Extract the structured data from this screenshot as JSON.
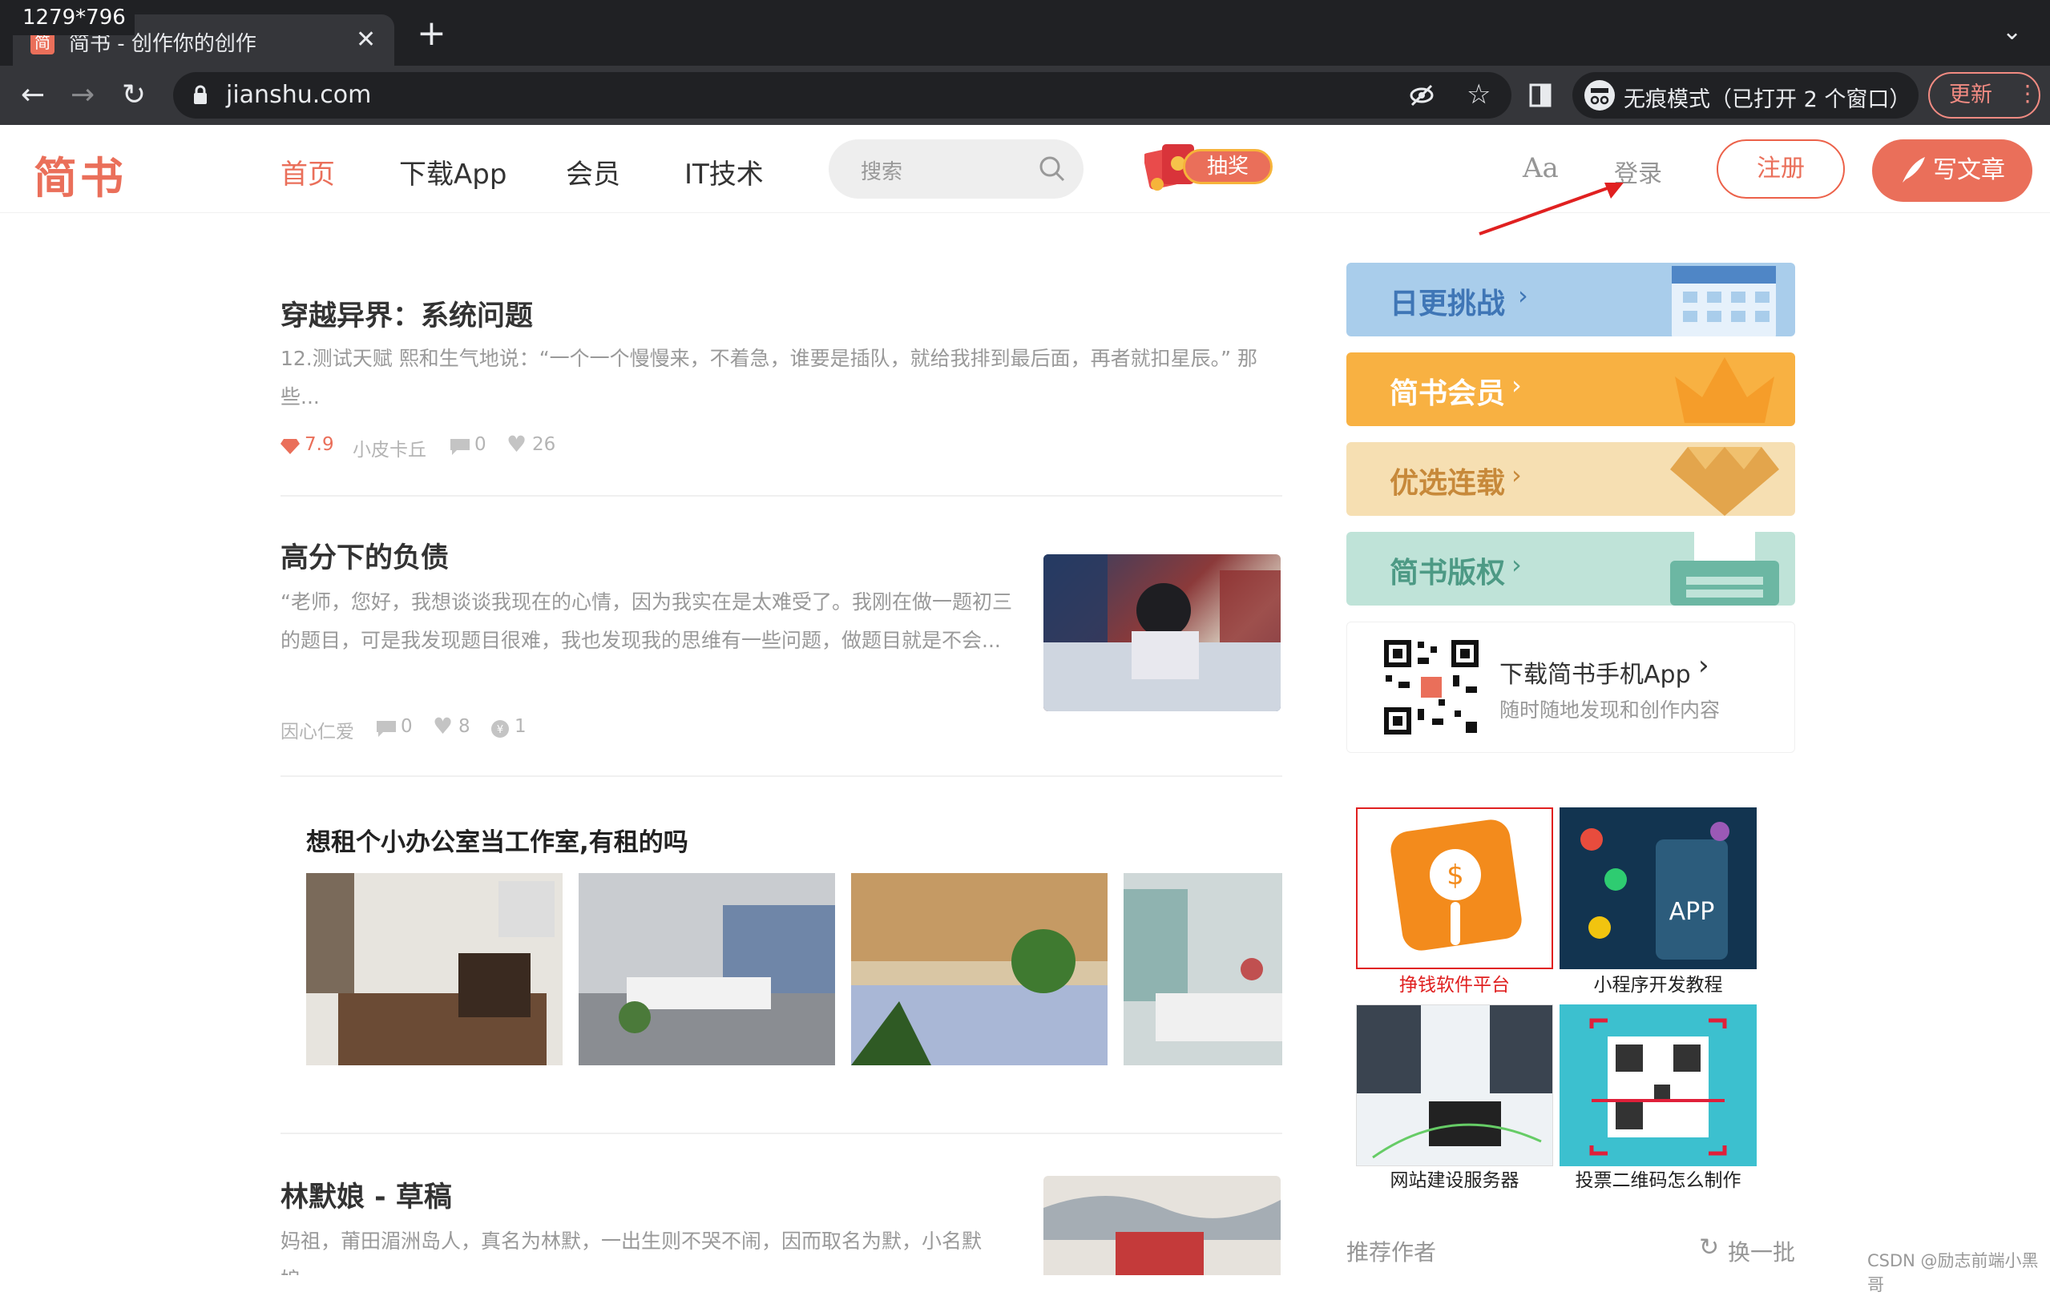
{
  "overlay": {
    "dimension_label": "1279*796"
  },
  "browser": {
    "tab_title": "简书 - 创作你的创作",
    "favicon_text": "简",
    "url": "jianshu.com",
    "incognito_text": "无痕模式（已打开 2 个窗口）",
    "update_label": "更新"
  },
  "site": {
    "logo": "简书",
    "nav": [
      "首页",
      "下载App",
      "会员",
      "IT技术"
    ],
    "search_placeholder": "搜索",
    "lottery_label": "抽奖",
    "font_toggle": "Aa",
    "login": "登录",
    "register": "注册",
    "write": "写文章",
    "accent_color": "#ea6f5a"
  },
  "articles": [
    {
      "title": "穿越异界：系统问题",
      "abstract": "12.测试天赋 熙和生气地说：“一个一个慢慢来，不着急，谁要是插队，就给我排到最后面，再者就扣星辰。” 那些...",
      "score": "7.9",
      "author": "小皮卡丘",
      "comments": "0",
      "likes": "26"
    },
    {
      "title": "高分下的负债",
      "abstract": "“老师，您好，我想谈谈我现在的心情，因为我实在是太难受了。我刚在做一题初三的题目，可是我发现题目很难，我也发现我的思维有一些问题，做题目就是不会...",
      "author": "因心仁爱",
      "comments": "0",
      "likes": "8",
      "rewards": "1"
    },
    {
      "title": "林默娘 - 草稿",
      "abstract": "妈祖，莆田湄洲岛人，真名为林默，一出生则不哭不闹，因而取名为默，小名默娘。"
    }
  ],
  "ad_block": {
    "title": "想租个小办公室当工作室,有租的吗"
  },
  "sidebar": {
    "banners": [
      "日更挑战",
      "简书会员",
      "优选连载",
      "简书版权"
    ],
    "app_download_title": "下载简书手机App",
    "app_download_sub": "随时随地发现和创作内容",
    "ads": [
      "挣钱软件平台",
      "小程序开发教程",
      "网站建设服务器",
      "投票二维码怎么制作"
    ],
    "recommended_authors": "推荐作者",
    "refresh": "换一批"
  },
  "watermark": "CSDN @励志前端小黑哥"
}
